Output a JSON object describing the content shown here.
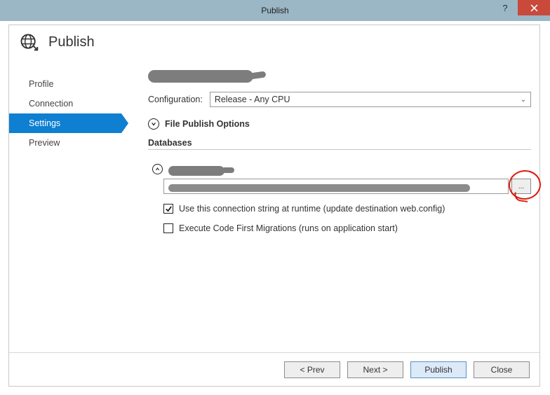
{
  "window": {
    "title": "Publish",
    "help": "?",
    "close_aria": "Close"
  },
  "header": {
    "title": "Publish"
  },
  "sidebar": {
    "items": [
      {
        "label": "Profile",
        "active": false
      },
      {
        "label": "Connection",
        "active": false
      },
      {
        "label": "Settings",
        "active": true
      },
      {
        "label": "Preview",
        "active": false
      }
    ]
  },
  "main": {
    "configuration_label": "Configuration:",
    "configuration_value": "Release - Any CPU",
    "file_publish_options": "File Publish Options",
    "databases_label": "Databases",
    "browse_label": "...",
    "check_runtime": "Use this connection string at runtime (update destination web.config)",
    "check_runtime_checked": true,
    "check_migrations": "Execute Code First Migrations (runs on application start)",
    "check_migrations_checked": false
  },
  "footer": {
    "prev": "< Prev",
    "next": "Next >",
    "publish": "Publish",
    "close": "Close"
  }
}
